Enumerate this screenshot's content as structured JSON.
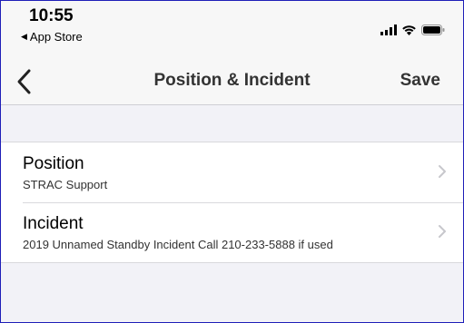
{
  "status_bar": {
    "time": "10:55",
    "back_app_label": "App Store",
    "icons": [
      "signal-icon",
      "wifi-icon",
      "battery-icon"
    ]
  },
  "nav": {
    "title": "Position & Incident",
    "save_label": "Save",
    "back_icon": "chevron-left-icon"
  },
  "rows": [
    {
      "title": "Position",
      "subtitle": "STRAC Support"
    },
    {
      "title": "Incident",
      "subtitle": "2019 Unnamed Standby Incident Call 210-233-5888 if used"
    }
  ],
  "colors": {
    "background": "#f2f2f7",
    "bar": "#f7f7f7",
    "chevron": "#c7c7cc"
  }
}
